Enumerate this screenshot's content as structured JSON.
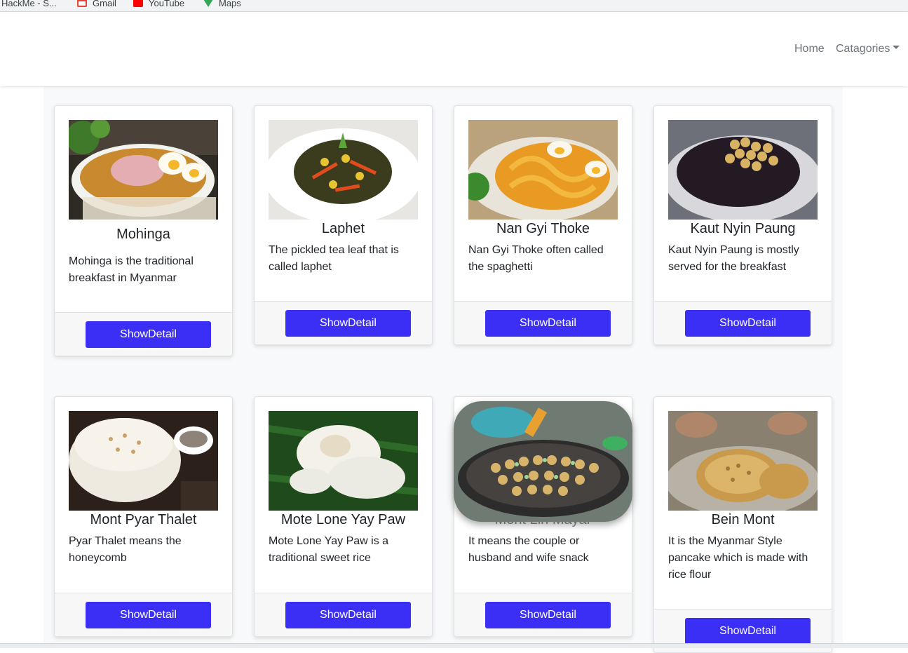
{
  "bookmarks": [
    {
      "label": "HackMe - S...",
      "icon": "bookmark-icon"
    },
    {
      "label": "Gmail",
      "icon": "gmail-icon"
    },
    {
      "label": "YouTube",
      "icon": "youtube-icon"
    },
    {
      "label": "Maps",
      "icon": "maps-icon"
    }
  ],
  "nav": {
    "home": "Home",
    "categories": "Catagories"
  },
  "cards": [
    {
      "title": "Mohinga",
      "text": "Mohinga is the traditional breakfast in Myanmar",
      "button": "ShowDetail"
    },
    {
      "title": "Laphet",
      "text": "The pickled tea leaf that is called laphet",
      "button": "ShowDetail"
    },
    {
      "title": "Nan Gyi Thoke",
      "text": "Nan Gyi Thoke often called the spaghetti",
      "button": "ShowDetail"
    },
    {
      "title": "Kaut Nyin Paung",
      "text": "Kaut Nyin Paung is mostly served for the breakfast",
      "button": "ShowDetail"
    },
    {
      "title": "Mont Pyar Thalet",
      "text": "Pyar Thalet means the honeycomb",
      "button": "ShowDetail"
    },
    {
      "title": "Mote Lone Yay Paw",
      "text": "Mote Lone Yay Paw is a traditional sweet rice",
      "button": "ShowDetail"
    },
    {
      "title": "Mont Lin Mayar",
      "text": "It means the couple or husband and wife snack",
      "button": "ShowDetail"
    },
    {
      "title": "Bein Mont",
      "text": "It is the Myanmar Style pancake which is made with rice flour",
      "button": "ShowDetail"
    }
  ],
  "colors": {
    "button": "#3b2ff5",
    "page_bg": "#f8f9fa",
    "nav_link": "#6c757d"
  }
}
